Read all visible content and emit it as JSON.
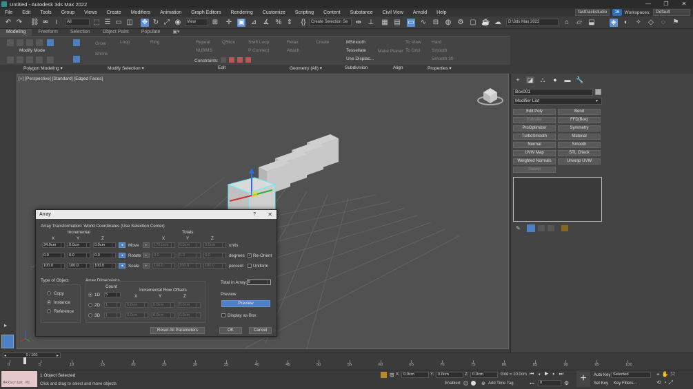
{
  "window": {
    "title": "Untitled - Autodesk 3ds Max 2022",
    "controls": [
      "—",
      "❐",
      "✕"
    ]
  },
  "menu": [
    "File",
    "Edit",
    "Tools",
    "Group",
    "Views",
    "Create",
    "Modifiers",
    "Animation",
    "Graph Editors",
    "Rendering",
    "Customize",
    "Scripting",
    "Content",
    "Substance",
    "Civil View",
    "Arnold",
    "Help"
  ],
  "account": {
    "user": "fasttrackstudio",
    "notifications": "16",
    "workspace_label": "Workspaces:",
    "workspace": "Default"
  },
  "toolbar": {
    "filter": "All",
    "view": "View",
    "selection_set": "Create Selection Se",
    "project_path": "D:\\3ds Max 2022"
  },
  "ribbon": {
    "tabs": [
      "Modeling",
      "Freeform",
      "Selection",
      "Object Paint",
      "Populate"
    ],
    "modify_mode": "Modify Mode",
    "loop": "Loop",
    "ring": "Ring",
    "grow": "Grow",
    "shrink": "Shrink",
    "repeat": "Repeat",
    "nurms": "NURMS",
    "quickslice": "QSlice",
    "swiftloop": "Swift Loop",
    "pconnect": "P Connect",
    "relax": "Relax",
    "attach": "Attach",
    "create": "Create",
    "constraints": "Constraints:",
    "msmooth": "MSmooth",
    "tessellate": "Tessellate",
    "use_displace": "Use Displac...",
    "make_planar": "Make Planar",
    "to_view": "To View",
    "to_grid": "To Grid",
    "hard": "Hard",
    "smooth": "Smooth",
    "smooth30": "Smooth 30",
    "panels": [
      "Polygon Modeling ▾",
      "Modify Selection ▾",
      "Edit",
      "Geometry (All) ▾",
      "Subdivision",
      "Align",
      "Properties ▾"
    ]
  },
  "viewport": {
    "label": "[+] [Perspective] [Standard] [Edged Faces]"
  },
  "command_panel": {
    "object_name": "Box001",
    "modifier_list": "Modifier List",
    "modifiers": [
      {
        "label": "Edit Poly",
        "enabled": true
      },
      {
        "label": "Bend",
        "enabled": true
      },
      {
        "label": "Extrude",
        "enabled": false
      },
      {
        "label": "FFD(Box)",
        "enabled": true
      },
      {
        "label": "ProOptimizer",
        "enabled": true
      },
      {
        "label": "Symmetry",
        "enabled": true
      },
      {
        "label": "TurboSmooth",
        "enabled": true
      },
      {
        "label": "Material",
        "enabled": true
      },
      {
        "label": "Normal",
        "enabled": true
      },
      {
        "label": "Smooth",
        "enabled": true
      },
      {
        "label": "UVW Map",
        "enabled": true
      },
      {
        "label": "STL Check",
        "enabled": true
      },
      {
        "label": "Weighted Normals",
        "enabled": true
      },
      {
        "label": "Unwrap UVW",
        "enabled": true
      },
      {
        "label": "Sweep",
        "enabled": false
      }
    ]
  },
  "array_dialog": {
    "title": "Array",
    "help": "?",
    "close": "✕",
    "heading": "Array Transformation: World Coordinates (Use Selection Center)",
    "incremental": "Incremental",
    "totals": "Totals",
    "axes": [
      "X",
      "Y",
      "Z"
    ],
    "rows": [
      {
        "label": "Move",
        "inc": [
          "34.0cm",
          "0.0cm",
          "0.0cm"
        ],
        "tot": [
          "170.0cm",
          "0.0cm",
          "0.0cm"
        ],
        "unit": "units"
      },
      {
        "label": "Rotate",
        "inc": [
          "0.0",
          "0.0",
          "0.0"
        ],
        "tot": [
          "0.0",
          "0.0",
          "0.0"
        ],
        "unit": "degrees"
      },
      {
        "label": "Scale",
        "inc": [
          "100.0",
          "100.0",
          "100.0"
        ],
        "tot": [
          "100.0",
          "100.0",
          "100.0"
        ],
        "unit": "percent"
      }
    ],
    "reorient": "Re-Orient",
    "uniform": "Uniform",
    "type_of_object": "Type of Object",
    "types": [
      "Copy",
      "Instance",
      "Reference"
    ],
    "selected_type": "Instance",
    "array_dimensions": "Array Dimensions",
    "count_label": "Count",
    "row_offsets": "Incremental Row Offsets",
    "dims": [
      {
        "label": "1D",
        "count": "5",
        "offsets": []
      },
      {
        "label": "2D",
        "count": "1",
        "offsets": [
          "0.0cm",
          "0.0cm",
          "0.0cm"
        ]
      },
      {
        "label": "3D",
        "count": "1",
        "offsets": [
          "0.0cm",
          "0.0cm",
          "0.0cm"
        ]
      }
    ],
    "total_in_array_label": "Total in Array:",
    "total_in_array": "5",
    "preview_group": "Preview",
    "preview_button": "Preview",
    "display_as_box": "Display as Box",
    "reset_all": "Reset All Parameters",
    "ok": "OK",
    "cancel": "Cancel"
  },
  "timeline": {
    "frame_display": "0 / 100",
    "ticks": [
      0,
      5,
      10,
      15,
      20,
      25,
      30,
      35,
      40,
      45,
      50,
      55,
      60,
      65,
      70,
      75,
      80,
      85,
      90,
      95,
      100
    ]
  },
  "status": {
    "maxscript": "MAXScript Mi",
    "selection": "1 Object Selected",
    "prompt": "Click and drag to select and move objects",
    "x_label": "X:",
    "x": "0.0cm",
    "y_label": "Y:",
    "y": "0.0cm",
    "z_label": "Z:",
    "z": "0.0cm",
    "grid": "Grid = 10.0cm",
    "enabled": "Enabled:",
    "add_time_tag": "Add Time Tag",
    "autokey": "Auto Key",
    "setkey": "Set Key",
    "selected": "Selected",
    "key_filters": "Key Filters...",
    "frame": "0"
  }
}
